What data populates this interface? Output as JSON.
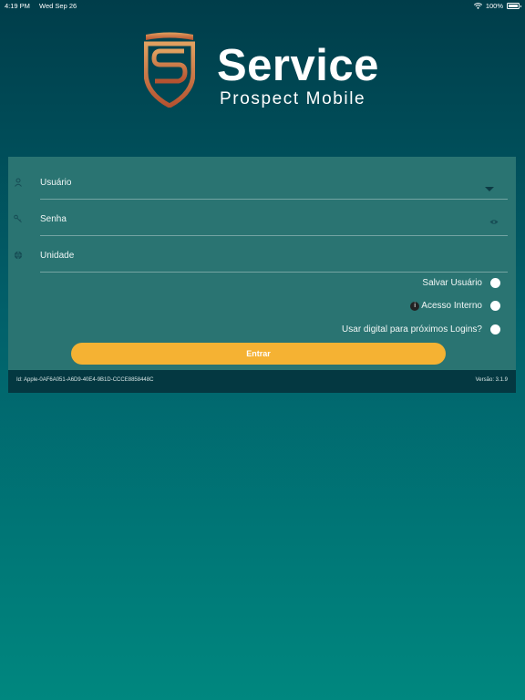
{
  "status_bar": {
    "time": "4:19 PM",
    "date": "Wed Sep 26",
    "battery": "100%"
  },
  "logo": {
    "brand": "Service",
    "subtitle": "Prospect Mobile"
  },
  "form": {
    "user_label": "Usuário",
    "password_label": "Senha",
    "unit_label": "Unidade",
    "save_user_label": "Salvar Usuário",
    "internal_access_label": "Acesso Interno",
    "fingerprint_label": "Usar digital para próximos Logins?",
    "submit_label": "Entrar"
  },
  "footer": {
    "device_id": "Id: Apple-0AF6A051-A6D9-40E4-9B1D-CCCE8858448C",
    "version": "Versão: 3.1.9"
  },
  "colors": {
    "accent": "#f5b233",
    "card": "#2a7472",
    "footer": "#043841",
    "logo_gradient_start": "#e0a060",
    "logo_gradient_end": "#b55230"
  },
  "icons": [
    "wifi-icon",
    "battery-icon",
    "shield-logo-icon",
    "user-icon",
    "password-icon",
    "globe-icon",
    "dropdown-icon",
    "eye-icon",
    "info-icon"
  ]
}
